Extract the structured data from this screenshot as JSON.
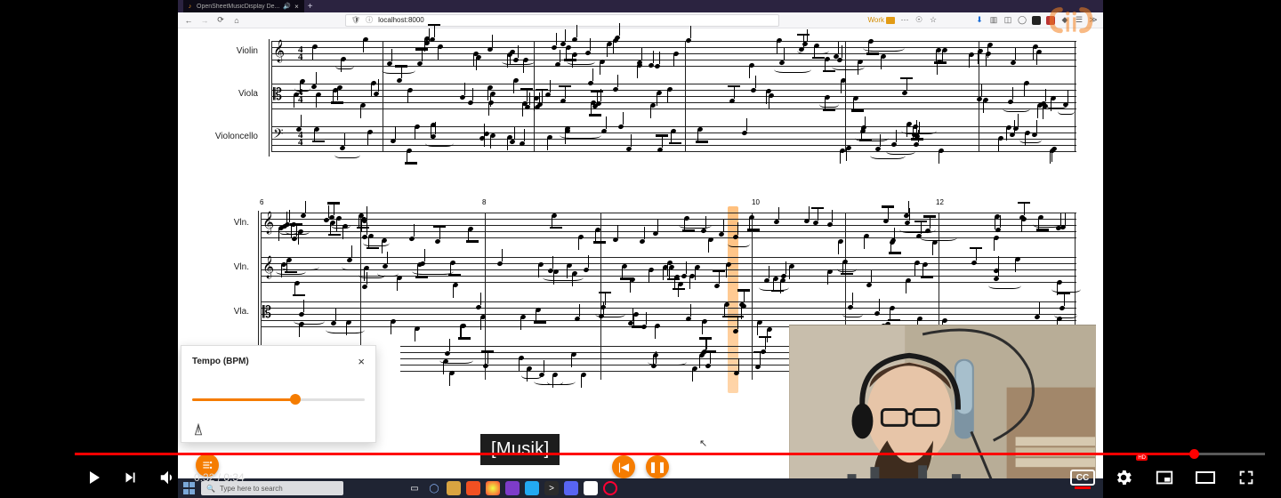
{
  "browser": {
    "tab_title": "OpenSheetMusicDisplay De...",
    "url": "localhost:8000",
    "url_port": "localhost:8000",
    "container_label": "Work"
  },
  "sheet": {
    "instruments_sys1": [
      "Violin",
      "Viola",
      "Violoncello"
    ],
    "instruments_sys2": [
      "Vln.",
      "Vln.",
      "Vla."
    ],
    "time_signature": {
      "top": "4",
      "bottom": "4"
    },
    "measure_numbers": [
      "6",
      "8",
      "10",
      "12"
    ]
  },
  "tempo_popup": {
    "title": "Tempo (BPM)"
  },
  "caption": "[Musik]",
  "youtube": {
    "time_current": "0:32",
    "time_sep": " / ",
    "time_total": "0:34",
    "cc_label": "CC",
    "hd_label": "HD",
    "progress_pct": 94
  },
  "taskbar": {
    "search_placeholder": "Type here to search"
  }
}
